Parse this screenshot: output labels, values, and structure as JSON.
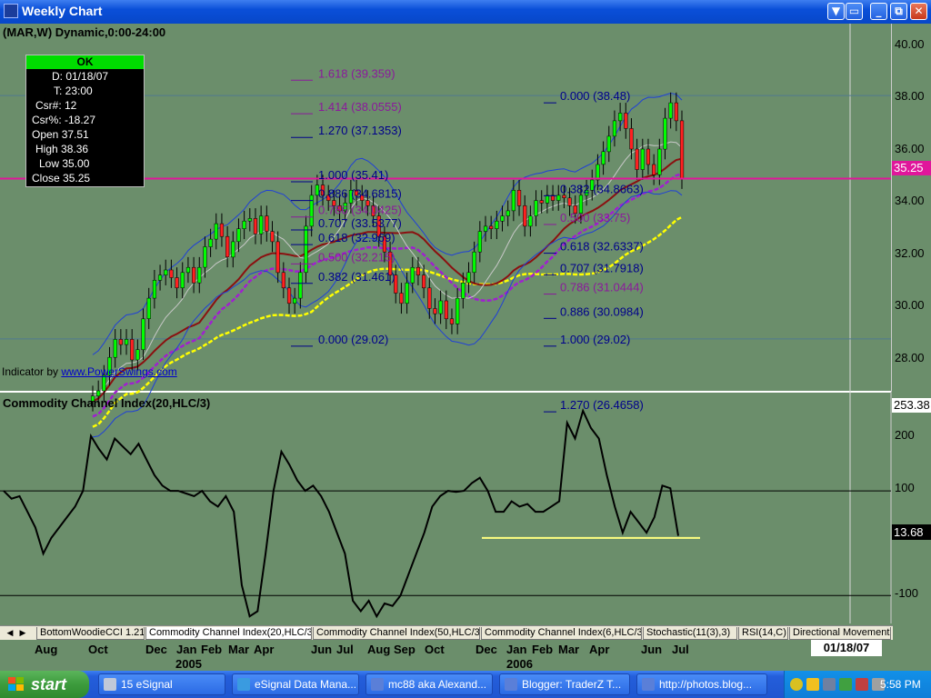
{
  "window": {
    "title": "Weekly Chart",
    "buttons": [
      "▼",
      "▭",
      "_",
      "⧉",
      "✕"
    ]
  },
  "symbol_line": "(MAR,W) Dynamic,0:00-24:00",
  "data_window": {
    "status": "OK",
    "rows": [
      "D: 01/18/07",
      "T: 23:00",
      "Csr#: 12",
      "Csr%: -18.27",
      "Open 37.51",
      "High 38.36",
      "Low 35.00",
      "Close 35.25"
    ]
  },
  "indicator_credit": {
    "prefix": "Indicator by ",
    "link": "www.PowerSwings.com"
  },
  "price_axis": {
    "ticks": [
      "40.00",
      "38.00",
      "36.00",
      "34.00",
      "32.00",
      "30.00",
      "28.00"
    ],
    "current": "35.25"
  },
  "cci_label": "Commodity Channel Index(20,HLC/3)",
  "cci_axis": {
    "ticks": [
      "200",
      "100",
      "-100"
    ],
    "top_value": "253.38",
    "current": "13.68"
  },
  "fib_left": [
    "1.618 (39.359)",
    "1.414 (38.0555)",
    "1.270 (37.1353)",
    "1.000 (35.41)",
    "0.886 (34.6815)",
    "0.786 (34.0425)",
    "0.707 (33.5377)",
    "0.618 (32.969)",
    "0.500 (32.215)",
    "0.382 (31.461)",
    "0.000 (29.02)"
  ],
  "fib_right": [
    "0.000 (38.48)",
    "0.382 (34.8663)",
    "0.500 (33.75)",
    "0.618 (32.6337)",
    "0.707 (31.7918)",
    "0.786 (31.0444)",
    "0.886 (30.0984)",
    "1.000 (29.02)",
    "1.270 (26.4658)"
  ],
  "tabs": [
    "BottomWoodieCCI 1.21",
    "Commodity Channel Index(20,HLC/3)",
    "Commodity Channel Index(50,HLC/3)",
    "Commodity Channel Index(6,HLC/3)",
    "Stochastic(11(3),3)",
    "RSI(14,C)",
    "Directional Movement("
  ],
  "time_axis": {
    "months": [
      "Aug",
      "Oct",
      "Dec",
      "Jan",
      "Feb",
      "Mar",
      "Apr",
      "Jun",
      "Jul",
      "Aug",
      "Sep",
      "Oct",
      "Dec",
      "Jan",
      "Feb",
      "Mar",
      "Apr",
      "Jun",
      "Jul"
    ],
    "years": [
      "2005",
      "2006"
    ],
    "date_readout": "01/18/07"
  },
  "taskbar": {
    "start": "start",
    "tasks": [
      "15 eSignal",
      "eSignal Data Mana...",
      "mc88 aka Alexand...",
      "Blogger: TraderZ T...",
      "http://photos.blog..."
    ],
    "clock": "5:58 PM"
  },
  "colors": {
    "background": "#6b8e6b",
    "price_line": "#e0169b",
    "bollinger": "#1f3fd8",
    "ma_short": "#8b1010",
    "ma_mid": "#a020d0",
    "ma_long": "#ffff00",
    "fib_blue": "#00008b",
    "fib_purple": "#8b1a9b"
  },
  "chart_data": [
    {
      "type": "candlestick",
      "title": "(MAR,W) Dynamic,0:00-24:00",
      "ylim": [
        27,
        40.5
      ],
      "y_ticks": [
        28,
        30,
        32,
        34,
        36,
        38,
        40
      ],
      "current_price": 35.25,
      "closes": [
        26.8,
        27.0,
        27.6,
        28.3,
        29.0,
        28.8,
        29.0,
        28.2,
        28.6,
        29.8,
        30.6,
        31.3,
        31.5,
        31.7,
        31.4,
        31.0,
        31.6,
        31.8,
        31.2,
        31.8,
        32.6,
        32.9,
        33.5,
        33.0,
        32.2,
        32.8,
        33.3,
        33.6,
        33.7,
        33.1,
        33.8,
        33.2,
        32.8,
        31.6,
        31.0,
        30.4,
        30.6,
        31.6,
        33.4,
        34.6,
        35.0,
        34.6,
        34.4,
        34.2,
        34.0,
        34.3,
        34.8,
        34.6,
        34.4,
        34.2,
        33.8,
        33.0,
        32.4,
        31.5,
        30.8,
        30.4,
        31.2,
        31.8,
        31.5,
        31.0,
        30.2,
        30.0,
        30.5,
        29.8,
        29.6,
        30.6,
        31.2,
        31.6,
        32.4,
        33.2,
        33.4,
        33.3,
        33.6,
        33.8,
        34.0,
        34.8,
        34.2,
        33.4,
        33.8,
        34.4,
        34.3,
        34.6,
        34.4,
        34.6,
        34.5,
        34.2,
        33.9,
        34.6,
        34.8,
        35.2,
        35.8,
        36.3,
        36.9,
        37.5,
        37.8,
        37.2,
        36.4,
        35.6,
        36.4,
        35.8,
        35.4,
        36.4,
        37.6,
        38.2,
        37.5,
        35.25
      ],
      "fib_levels_left": [
        39.359,
        38.0555,
        37.1353,
        35.41,
        34.6815,
        34.0425,
        33.5377,
        32.969,
        32.215,
        31.461,
        29.02
      ],
      "fib_levels_right": [
        38.48,
        34.8663,
        33.75,
        32.6337,
        31.7918,
        31.0444,
        30.0984,
        29.02,
        26.4658
      ]
    },
    {
      "type": "line",
      "title": "Commodity Channel Index(20,HLC/3)",
      "ylim": [
        -150,
        260
      ],
      "y_ticks": [
        200,
        100,
        -100
      ],
      "reference_lines": [
        100,
        -100
      ],
      "support_level": 10,
      "current_value": 13.68,
      "values": [
        100,
        85,
        90,
        60,
        30,
        -20,
        10,
        30,
        50,
        70,
        100,
        205,
        180,
        160,
        200,
        185,
        170,
        190,
        160,
        130,
        110,
        100,
        100,
        95,
        90,
        100,
        80,
        70,
        90,
        60,
        -80,
        -140,
        -130,
        -20,
        100,
        175,
        150,
        120,
        100,
        110,
        90,
        60,
        20,
        -20,
        -110,
        -130,
        -110,
        -140,
        -115,
        -120,
        -100,
        -60,
        -20,
        20,
        70,
        90,
        100,
        98,
        100,
        115,
        125,
        100,
        60,
        60,
        80,
        70,
        75,
        60,
        60,
        70,
        80,
        230,
        200,
        253,
        220,
        200,
        130,
        70,
        20,
        60,
        40,
        20,
        50,
        110,
        105,
        14
      ]
    }
  ]
}
